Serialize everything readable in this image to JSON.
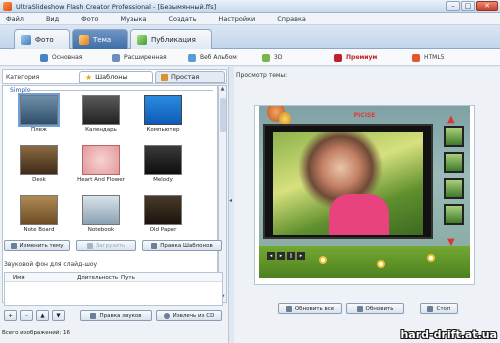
{
  "window": {
    "title": "UltraSlideshow Flash Creator Professional - [Безымянный.ffs]",
    "minimize_glyph": "–",
    "maximize_glyph": "□",
    "close_glyph": "✕"
  },
  "menu": [
    "Файл",
    "Вид",
    "Фото",
    "Музыка",
    "Создать",
    "Настройки",
    "Справка"
  ],
  "main_tabs": [
    {
      "label": "Фото",
      "icon": "photo-icon"
    },
    {
      "label": "Тема",
      "icon": "theme-icon",
      "active": true
    },
    {
      "label": "Публикация",
      "icon": "publish-icon"
    }
  ],
  "sub_tabs": [
    {
      "label": "Основная",
      "icon": "basic-icon"
    },
    {
      "label": "Расширенная",
      "icon": "advanced-icon"
    },
    {
      "label": "Веб Альбом",
      "icon": "web-album-icon"
    },
    {
      "label": "3D",
      "icon": "3d-icon"
    },
    {
      "label": "Премиум",
      "icon": "premium-icon",
      "active": true
    },
    {
      "label": "HTML5",
      "icon": "html5-icon"
    }
  ],
  "left": {
    "category_label": "Категория",
    "tab_templates": "Шаблоны",
    "tab_simple": "Простая",
    "group_label": "Simple",
    "templates": [
      "Плеж",
      "Календарь",
      "Компьютер",
      "Desk",
      "Heart And Flower",
      "Melody",
      "Note Board",
      "Notebook",
      "Old Paper"
    ],
    "btn_change_theme": "Изменить тему",
    "btn_load": "Загрузить",
    "btn_template_help": "Правка Шаблонов",
    "audio_title": "Звуковой фон для слайд-шоу",
    "audio_columns": [
      "Имя",
      "Длительность",
      "Путь"
    ],
    "btn_edit_sound": "Правка звуков",
    "btn_extract_cd": "Извлечь из CD",
    "status_label": "Всего изображений:",
    "status_count": "16"
  },
  "right": {
    "preview_label": "Просмотр темы:",
    "preview_title": "PICISE",
    "btn_refresh_all": "Обновить все",
    "btn_refresh": "Обновить",
    "btn_stop": "Стоп"
  },
  "watermark": "hard-drift.at.ua",
  "colors": {
    "accent": "#3e6ea8",
    "premium": "#c0202a"
  }
}
